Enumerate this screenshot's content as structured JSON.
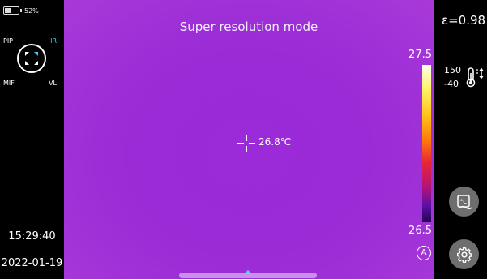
{
  "status": {
    "battery_percent": "52%",
    "battery_level": 0.52
  },
  "mode_dial": {
    "pip": "PIP",
    "ir": "IR",
    "mif": "MIF",
    "vl": "VL",
    "active": "IR"
  },
  "datetime": {
    "time": "15:29:40",
    "date": "2022-01-19"
  },
  "thermal": {
    "mode_title": "Super resolution mode",
    "center_temperature": "26.8℃",
    "scale_max": "27.5",
    "scale_min": "26.5",
    "auto_label": "A",
    "colors": {
      "background": "#9b2ad9",
      "handle": "#c890e8",
      "active": "#33ccff"
    }
  },
  "right_panel": {
    "emissivity": "ε=0.98",
    "range_high": "150",
    "range_low": "-40",
    "icons": [
      "thermometer-range-icon",
      "image-temperature-icon",
      "settings-gear-icon"
    ]
  }
}
